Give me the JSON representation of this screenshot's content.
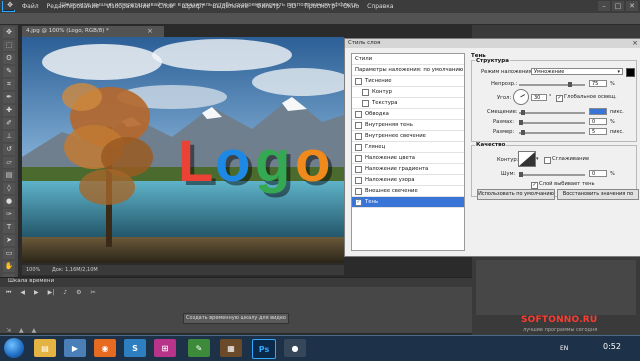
{
  "app": {
    "logo": "Ps",
    "menu": [
      "Файл",
      "Редактирование",
      "Изображение",
      "Слои",
      "Шрифт",
      "Выделение",
      "Фильтр",
      "3D",
      "Просмотр",
      "Окно",
      "Справка"
    ],
    "window_controls": [
      "–",
      "□",
      "✕"
    ]
  },
  "options_bar": {
    "hint": "Щелкните мышью и перетаскивайте ее в указатель, чтобы скорректировать расположение эффекта."
  },
  "document": {
    "tab_title": "4.jpg @ 100% (Logo, RGB/8) *",
    "logo_letters": [
      "L",
      "o",
      "g",
      "o"
    ],
    "logo_colors": [
      "#ea4335",
      "#1e88e5",
      "#34a853",
      "#f08a1c"
    ],
    "status_zoom": "100%",
    "status_doc": "Док: 1,16M/2,10M"
  },
  "timeline": {
    "tab_label": "Шкала времени",
    "create_button": "Создать временную шкалу для видео"
  },
  "layer_style": {
    "title": "Стиль слоя",
    "styles": [
      {
        "label": "Стили",
        "header": true
      },
      {
        "label": "Параметры наложения: по умолчанию",
        "header": true
      },
      {
        "label": "Тиснение",
        "checked": false
      },
      {
        "label": "Контур",
        "checked": false,
        "indent": true
      },
      {
        "label": "Текстура",
        "checked": false,
        "indent": true
      },
      {
        "label": "Обводка",
        "checked": false
      },
      {
        "label": "Внутренняя тень",
        "checked": false
      },
      {
        "label": "Внутреннее свечение",
        "checked": false
      },
      {
        "label": "Глянец",
        "checked": false
      },
      {
        "label": "Наложение цвета",
        "checked": false
      },
      {
        "label": "Наложение градиента",
        "checked": false
      },
      {
        "label": "Наложение узора",
        "checked": false
      },
      {
        "label": "Внешнее свечение",
        "checked": false
      },
      {
        "label": "Тень",
        "checked": true,
        "selected": true
      }
    ],
    "shadow": {
      "group": "Тень",
      "structure": "Структура",
      "blend_mode_label": "Режим наложения:",
      "blend_mode_value": "Умножение",
      "opacity_label": "Непрозр.:",
      "opacity_value": "75",
      "angle_label": "Угол:",
      "angle_value": "30",
      "global_light_label": "Глобальное освещ.",
      "distance_label": "Смещение:",
      "distance_value": "",
      "size_unit": "пикс.",
      "spread_label": "Размах:",
      "spread_value": "0",
      "size_label": "Размер:",
      "size_value": "5",
      "percent": "%",
      "degree": "°",
      "quality": "Качество",
      "contour_label": "Контур:",
      "antialias_label": "Сглаживание",
      "noise_label": "Шум:",
      "noise_value": "0",
      "knockout_label": "Слой выбивает тень",
      "btn_default": "Использовать по умолчанию",
      "btn_reset": "Восстановить значения по"
    }
  },
  "taskbar": {
    "lang": "EN",
    "time": "0:52"
  },
  "watermark": {
    "text": "SOFTONNO.RU",
    "sub": "лучшие программы сегодня"
  }
}
